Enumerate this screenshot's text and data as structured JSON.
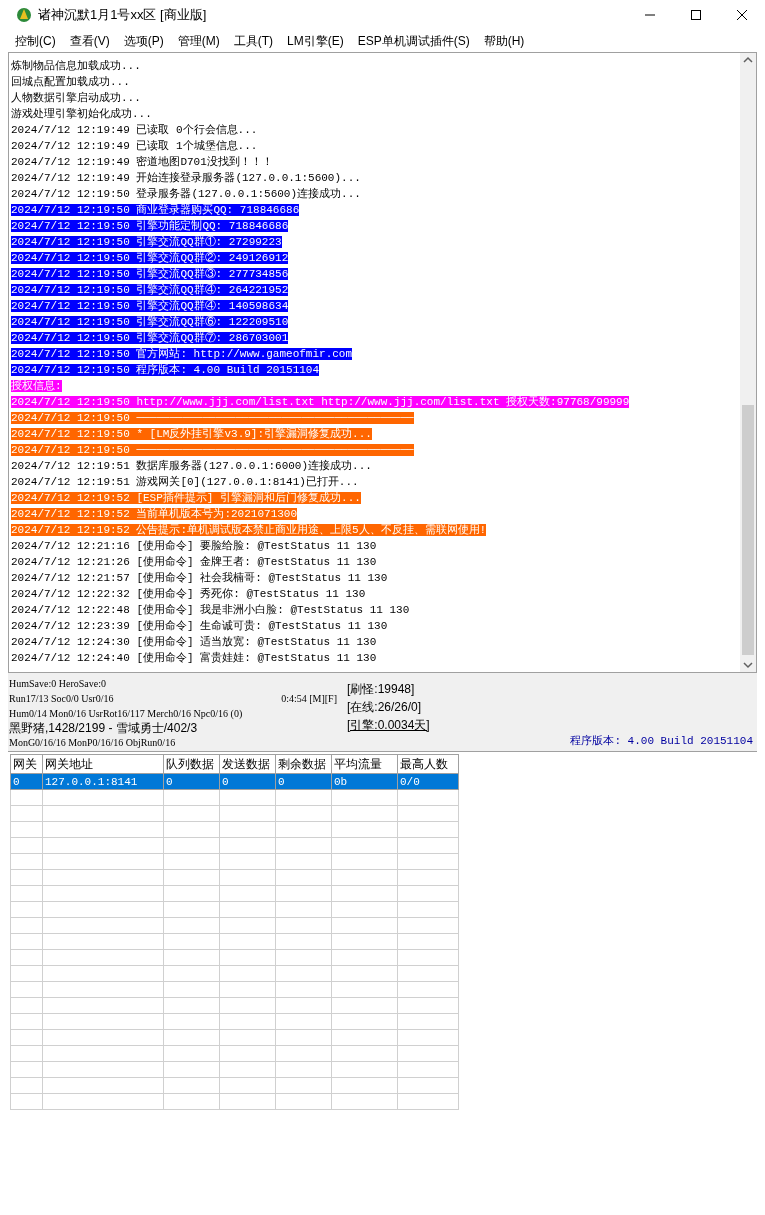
{
  "window": {
    "title": "诸神沉默1月1号xx区 [商业版]"
  },
  "menu": [
    "控制(C)",
    "查看(V)",
    "选项(P)",
    "管理(M)",
    "工具(T)",
    "LM引擎(E)",
    "ESP单机调试插件(S)",
    "帮助(H)"
  ],
  "log": [
    {
      "text": "炼制物品信息加载成功...",
      "kind": "plain"
    },
    {
      "text": "回城点配置加载成功...",
      "kind": "plain"
    },
    {
      "text": "人物数据引擎启动成功...",
      "kind": "plain"
    },
    {
      "text": "游戏处理引擎初始化成功...",
      "kind": "plain"
    },
    {
      "text": "2024/7/12 12:19:49 已读取 0个行会信息...",
      "kind": "plain"
    },
    {
      "text": "2024/7/12 12:19:49 已读取 1个城堡信息...",
      "kind": "plain"
    },
    {
      "text": "2024/7/12 12:19:49 密道地图D701没找到！！！",
      "kind": "plain"
    },
    {
      "text": "2024/7/12 12:19:49 开始连接登录服务器(127.0.0.1:5600)...",
      "kind": "plain"
    },
    {
      "text": "2024/7/12 12:19:50 登录服务器(127.0.0.1:5600)连接成功...",
      "kind": "plain"
    },
    {
      "text": "2024/7/12 12:19:50 商业登录器购买QQ: 718846686",
      "kind": "info"
    },
    {
      "text": "2024/7/12 12:19:50 引擎功能定制QQ: 718846686",
      "kind": "info"
    },
    {
      "text": "2024/7/12 12:19:50 引擎交流QQ群①: 27299223",
      "kind": "info"
    },
    {
      "text": "2024/7/12 12:19:50 引擎交流QQ群②: 249126912",
      "kind": "info"
    },
    {
      "text": "2024/7/12 12:19:50 引擎交流QQ群③: 277734856",
      "kind": "info"
    },
    {
      "text": "2024/7/12 12:19:50 引擎交流QQ群④: 264221952",
      "kind": "info"
    },
    {
      "text": "2024/7/12 12:19:50 引擎交流QQ群④: 140598634",
      "kind": "info"
    },
    {
      "text": "2024/7/12 12:19:50 引擎交流QQ群⑥: 122209510",
      "kind": "info"
    },
    {
      "text": "2024/7/12 12:19:50 引擎交流QQ群⑦: 286703001",
      "kind": "info"
    },
    {
      "text": "2024/7/12 12:19:50 官方网站: http://www.gameofmir.com",
      "kind": "info"
    },
    {
      "text": "2024/7/12 12:19:50 程序版本: 4.00 Build 20151104",
      "kind": "info"
    },
    {
      "text": "授权信息:",
      "kind": "license"
    },
    {
      "text": "2024/7/12 12:19:50 http://www.jjj.com/list.txt http://www.jjj.com/list.txt 授权天数:97768/99999",
      "kind": "license"
    },
    {
      "text": "2024/7/12 12:19:50 ──────────────────────────────────────────",
      "kind": "notice"
    },
    {
      "text": "2024/7/12 12:19:50 * [LM反外挂引擎v3.9]:引擎漏洞修复成功...",
      "kind": "notice"
    },
    {
      "text": "2024/7/12 12:19:50 ──────────────────────────────────────────",
      "kind": "notice"
    },
    {
      "text": "2024/7/12 12:19:51 数据库服务器(127.0.0.1:6000)连接成功...",
      "kind": "plain"
    },
    {
      "text": "2024/7/12 12:19:51 游戏网关[0](127.0.0.1:8141)已打开...",
      "kind": "plain"
    },
    {
      "text": "2024/7/12 12:19:52 [ESP插件提示] 引擎漏洞和后门修复成功...",
      "kind": "notice"
    },
    {
      "text": "2024/7/12 12:19:52 当前单机版本号为:2021071300",
      "kind": "notice"
    },
    {
      "text": "2024/7/12 12:19:52 公告提示:单机调试版本禁止商业用途、上限5人、不反挂、需联网使用!",
      "kind": "notice"
    },
    {
      "text": "2024/7/12 12:21:16 [使用命令] 要脸给脸: @TestStatus 11 130",
      "kind": "plain"
    },
    {
      "text": "2024/7/12 12:21:26 [使用命令] 金牌王者: @TestStatus 11 130",
      "kind": "plain"
    },
    {
      "text": "2024/7/12 12:21:57 [使用命令] 社会我楠哥: @TestStatus 11 130",
      "kind": "plain"
    },
    {
      "text": "2024/7/12 12:22:32 [使用命令] 秀死你: @TestStatus 11 130",
      "kind": "plain"
    },
    {
      "text": "2024/7/12 12:22:48 [使用命令] 我是非洲小白脸: @TestStatus 11 130",
      "kind": "plain"
    },
    {
      "text": "2024/7/12 12:23:39 [使用命令] 生命诚可贵: @TestStatus 11 130",
      "kind": "plain"
    },
    {
      "text": "2024/7/12 12:24:30 [使用命令] 适当放宽: @TestStatus 11 130",
      "kind": "plain"
    },
    {
      "text": "2024/7/12 12:24:40 [使用命令] 富贵娃娃: @TestStatus 11 130",
      "kind": "plain"
    }
  ],
  "status": {
    "lines": [
      "HumSave:0 HeroSave:0",
      "Run17/13 Soc0/0 Usr0/16",
      "Hum0/14 Mon0/16 UsrRot16/117 Merch0/16 Npc0/16 (0)",
      "黑野猪,1428/2199 - 雪域勇士/402/3",
      "MonG0/16/16 MonP0/16/16 ObjRun0/16"
    ],
    "timer": "0:4:54 [M][F]",
    "counters": [
      {
        "text": "[刷怪:19948]",
        "underlined": false
      },
      {
        "text": "[在线:26/26/0]",
        "underlined": false
      },
      {
        "text": "[引擎:0.0034天]",
        "underlined": true
      }
    ],
    "version": "程序版本: 4.00 Build 20151104"
  },
  "table": {
    "columns": [
      "网关",
      "网关地址",
      "队列数据",
      "发送数据",
      "剩余数据",
      "平均流量",
      "最高人数"
    ],
    "rows": [
      {
        "cells": [
          "0",
          "127.0.0.1:8141",
          "0",
          "0",
          "0",
          "0b",
          "0/0"
        ],
        "selected": true
      }
    ]
  }
}
